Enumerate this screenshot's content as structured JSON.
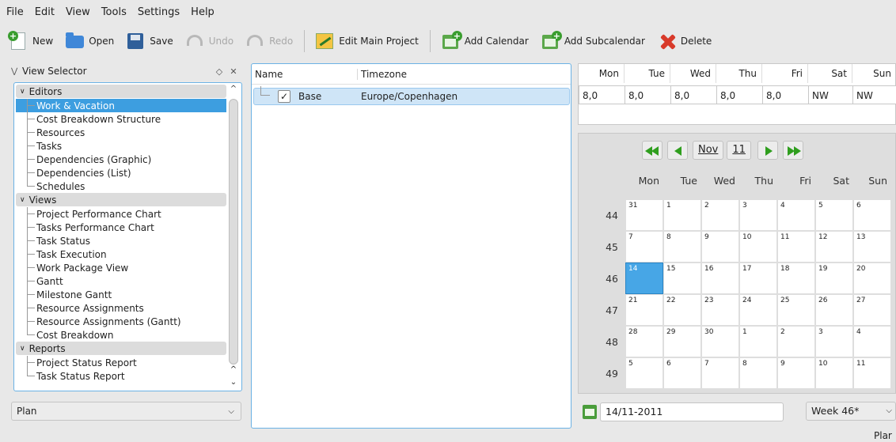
{
  "menu": [
    "File",
    "Edit",
    "View",
    "Tools",
    "Settings",
    "Help"
  ],
  "toolbar": {
    "new": "New",
    "open": "Open",
    "save": "Save",
    "undo": "Undo",
    "redo": "Redo",
    "edit_main": "Edit Main Project",
    "add_calendar": "Add Calendar",
    "add_subcalendar": "Add Subcalendar",
    "delete": "Delete"
  },
  "view_selector": {
    "title": "View Selector",
    "categories": [
      {
        "label": "Editors",
        "items": [
          "Work & Vacation",
          "Cost Breakdown Structure",
          "Resources",
          "Tasks",
          "Dependencies (Graphic)",
          "Dependencies (List)",
          "Schedules"
        ]
      },
      {
        "label": "Views",
        "items": [
          "Project Performance Chart",
          "Tasks Performance Chart",
          "Task Status",
          "Task Execution",
          "Work Package View",
          "Gantt",
          "Milestone Gantt",
          "Resource Assignments",
          "Resource Assignments (Gantt)",
          "Cost Breakdown"
        ]
      },
      {
        "label": "Reports",
        "items": [
          "Project Status Report",
          "Task Status Report"
        ]
      }
    ],
    "selected": "Work & Vacation",
    "plan_combo": "Plan"
  },
  "calendar_list": {
    "col_name": "Name",
    "col_timezone": "Timezone",
    "rows": [
      {
        "name": "Base",
        "timezone": "Europe/Copenhagen",
        "checked": true
      }
    ]
  },
  "week_hours": {
    "days": [
      "Mon",
      "Tue",
      "Wed",
      "Thu",
      "Fri",
      "Sat",
      "Sun"
    ],
    "values": [
      "8,0",
      "8,0",
      "8,0",
      "8,0",
      "8,0",
      "NW",
      "NW"
    ]
  },
  "month_calendar": {
    "month": "Nov",
    "year": "11",
    "day_headers": [
      "Mon",
      "Tue",
      "Wed",
      "Thu",
      "Fri",
      "Sat",
      "Sun"
    ],
    "weeks": [
      {
        "num": "44",
        "days": [
          "31",
          "1",
          "2",
          "3",
          "4",
          "5",
          "6"
        ]
      },
      {
        "num": "45",
        "days": [
          "7",
          "8",
          "9",
          "10",
          "11",
          "12",
          "13"
        ]
      },
      {
        "num": "46",
        "days": [
          "14",
          "15",
          "16",
          "17",
          "18",
          "19",
          "20"
        ]
      },
      {
        "num": "47",
        "days": [
          "21",
          "22",
          "23",
          "24",
          "25",
          "26",
          "27"
        ]
      },
      {
        "num": "48",
        "days": [
          "28",
          "29",
          "30",
          "1",
          "2",
          "3",
          "4"
        ]
      },
      {
        "num": "49",
        "days": [
          "5",
          "6",
          "7",
          "8",
          "9",
          "10",
          "11"
        ]
      }
    ],
    "selected_day": "14",
    "date_input": "14/11-2011",
    "week_combo": "Week 46*"
  },
  "status_text": "Plar",
  "colors": {
    "accent": "#3d9ee0",
    "nav_green": "#2f9e1e",
    "delete_red": "#d83a2a"
  }
}
